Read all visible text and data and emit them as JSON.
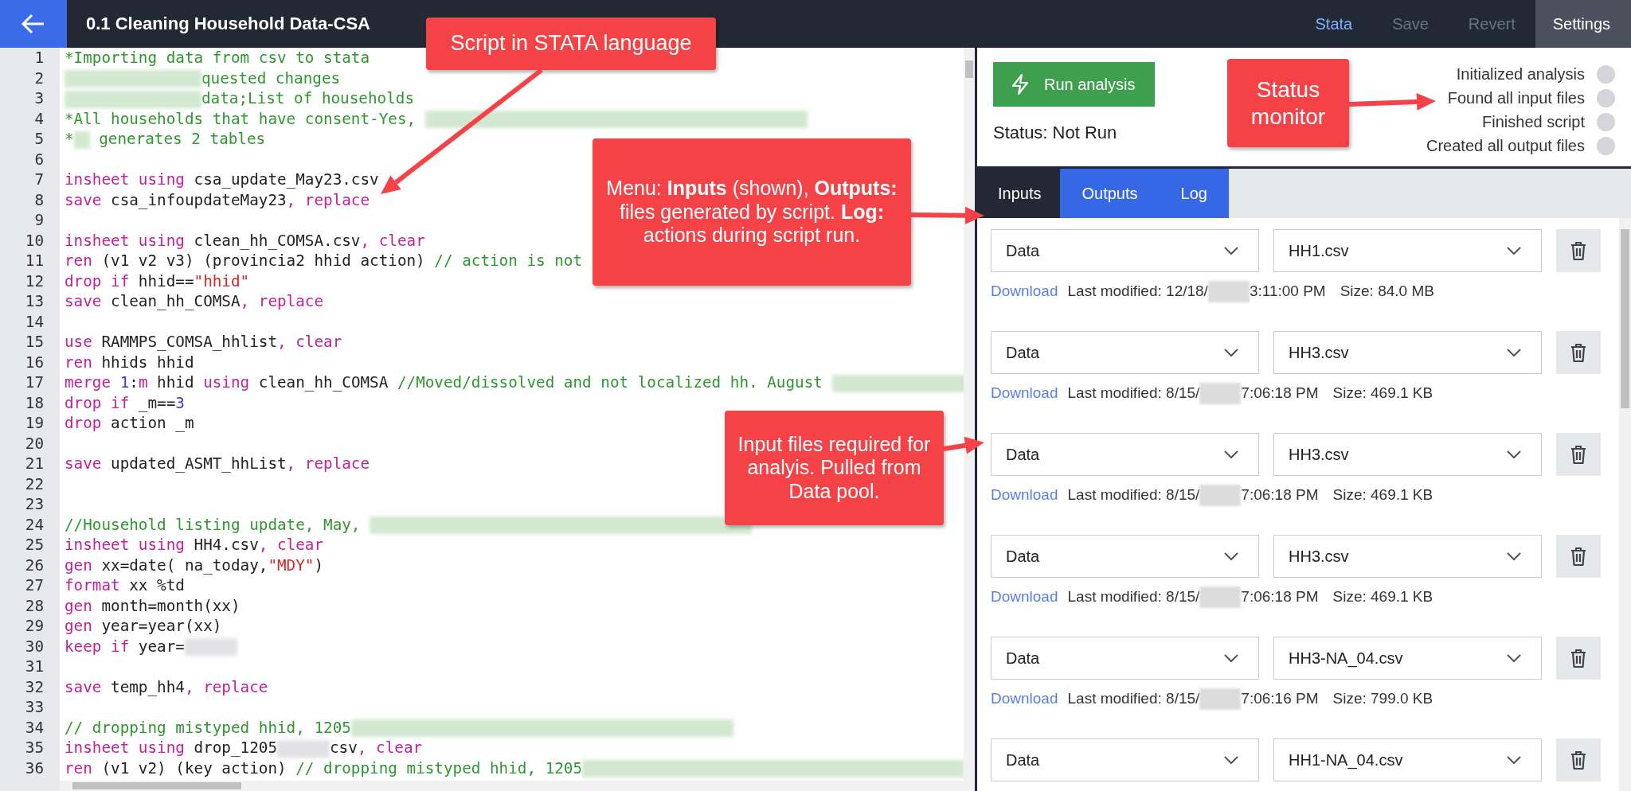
{
  "top_bar": {
    "title": "0.1 Cleaning Household Data-CSA",
    "actions": [
      {
        "label": "Stata",
        "kind": "link",
        "selected": true,
        "disabled": false
      },
      {
        "label": "Save",
        "kind": "link",
        "selected": false,
        "disabled": true
      },
      {
        "label": "Revert",
        "kind": "link",
        "selected": false,
        "disabled": true
      },
      {
        "label": "Settings",
        "kind": "panel",
        "selected": false,
        "disabled": false
      }
    ]
  },
  "editor": {
    "lines": [
      {
        "number": "1",
        "tokens": [
          {
            "kind": "comment",
            "text": "*Importing data from csv to stata"
          }
        ]
      },
      {
        "number": "2",
        "tokens": [
          {
            "kind": "redacted"
          },
          {
            "kind": "comment",
            "text": "quested changes"
          }
        ]
      },
      {
        "number": "3",
        "tokens": [
          {
            "kind": "redacted"
          },
          {
            "kind": "comment",
            "text": "data;List of households"
          }
        ]
      },
      {
        "number": "4",
        "tokens": [
          {
            "kind": "comment",
            "text": "*All households that have consent-Yes, "
          },
          {
            "kind": "redacted"
          }
        ]
      },
      {
        "number": "5",
        "tokens": [
          {
            "kind": "comment",
            "text": "*"
          },
          {
            "kind": "redacted"
          },
          {
            "kind": "comment",
            "text": " generates 2 tables"
          }
        ]
      },
      {
        "number": "6"
      },
      {
        "number": "7",
        "tokens": [
          {
            "kind": "keyword",
            "text": "insheet using"
          },
          {
            "kind": "plain",
            "text": " csa_update_May23.csv"
          }
        ]
      },
      {
        "number": "8",
        "tokens": [
          {
            "kind": "keyword",
            "text": "save"
          },
          {
            "kind": "plain",
            "text": " csa_infoupdateMay23"
          },
          {
            "kind": "keyword",
            "text": ", replace"
          }
        ]
      },
      {
        "number": "9"
      },
      {
        "number": "10",
        "tokens": [
          {
            "kind": "keyword",
            "text": "insheet using"
          },
          {
            "kind": "plain",
            "text": " clean_hh_COMSA.csv"
          },
          {
            "kind": "keyword",
            "text": ", clear"
          }
        ]
      },
      {
        "number": "11",
        "tokens": [
          {
            "kind": "keyword",
            "text": "ren"
          },
          {
            "kind": "plain",
            "text": " (v1 v2 v3) (provincia2 hhid action) "
          },
          {
            "kind": "comment",
            "text": "// action is not"
          }
        ]
      },
      {
        "number": "12",
        "tokens": [
          {
            "kind": "keyword",
            "text": "drop if"
          },
          {
            "kind": "plain",
            "text": " hhid=="
          },
          {
            "kind": "string",
            "text": "\"hhid\""
          }
        ]
      },
      {
        "number": "13",
        "tokens": [
          {
            "kind": "keyword",
            "text": "save"
          },
          {
            "kind": "plain",
            "text": " clean_hh_COMSA"
          },
          {
            "kind": "keyword",
            "text": ", replace"
          }
        ]
      },
      {
        "number": "14"
      },
      {
        "number": "15",
        "tokens": [
          {
            "kind": "keyword",
            "text": "use"
          },
          {
            "kind": "plain",
            "text": " RAMMPS_COMSA_hhlist"
          },
          {
            "kind": "keyword",
            "text": ", clear"
          }
        ]
      },
      {
        "number": "16",
        "tokens": [
          {
            "kind": "keyword",
            "text": "ren"
          },
          {
            "kind": "plain",
            "text": " hhids hhid"
          }
        ]
      },
      {
        "number": "17",
        "tokens": [
          {
            "kind": "keyword",
            "text": "merge"
          },
          {
            "kind": "number",
            "text": " 1"
          },
          {
            "kind": "plain",
            "text": ":"
          },
          {
            "kind": "keyword",
            "text": "m"
          },
          {
            "kind": "plain",
            "text": " hhid "
          },
          {
            "kind": "keyword",
            "text": "using"
          },
          {
            "kind": "plain",
            "text": " clean_hh_COMSA "
          },
          {
            "kind": "comment",
            "text": "//Moved/dissolved and not localized hh. August "
          },
          {
            "kind": "redacted"
          }
        ]
      },
      {
        "number": "18",
        "tokens": [
          {
            "kind": "keyword",
            "text": "drop if"
          },
          {
            "kind": "plain",
            "text": " _m=="
          },
          {
            "kind": "number",
            "text": "3"
          }
        ]
      },
      {
        "number": "19",
        "tokens": [
          {
            "kind": "keyword",
            "text": "drop"
          },
          {
            "kind": "plain",
            "text": " action _m"
          }
        ]
      },
      {
        "number": "20"
      },
      {
        "number": "21",
        "tokens": [
          {
            "kind": "keyword",
            "text": "save"
          },
          {
            "kind": "plain",
            "text": " updated_ASMT_hhList"
          },
          {
            "kind": "keyword",
            "text": ", replace"
          }
        ]
      },
      {
        "number": "22"
      },
      {
        "number": "23"
      },
      {
        "number": "24",
        "tokens": [
          {
            "kind": "comment",
            "text": "//Household listing update, May, "
          },
          {
            "kind": "redacted"
          }
        ]
      },
      {
        "number": "25",
        "tokens": [
          {
            "kind": "keyword",
            "text": "insheet using"
          },
          {
            "kind": "plain",
            "text": " HH4.csv"
          },
          {
            "kind": "keyword",
            "text": ", clear"
          }
        ]
      },
      {
        "number": "26",
        "tokens": [
          {
            "kind": "keyword",
            "text": "gen"
          },
          {
            "kind": "plain",
            "text": " xx=date( na_today,"
          },
          {
            "kind": "string",
            "text": "\"MDY\""
          },
          {
            "kind": "plain",
            "text": ")"
          }
        ]
      },
      {
        "number": "27",
        "tokens": [
          {
            "kind": "keyword",
            "text": "format"
          },
          {
            "kind": "plain",
            "text": " xx %td"
          }
        ]
      },
      {
        "number": "28",
        "tokens": [
          {
            "kind": "keyword",
            "text": "gen"
          },
          {
            "kind": "plain",
            "text": " month=month(xx)"
          }
        ]
      },
      {
        "number": "29",
        "tokens": [
          {
            "kind": "keyword",
            "text": "gen"
          },
          {
            "kind": "plain",
            "text": " year=year(xx)"
          }
        ]
      },
      {
        "number": "30",
        "tokens": [
          {
            "kind": "keyword",
            "text": "keep if"
          },
          {
            "kind": "plain",
            "text": " year="
          },
          {
            "kind": "redacted"
          }
        ]
      },
      {
        "number": "31"
      },
      {
        "number": "32",
        "tokens": [
          {
            "kind": "keyword",
            "text": "save"
          },
          {
            "kind": "plain",
            "text": " temp_hh4"
          },
          {
            "kind": "keyword",
            "text": ", replace"
          }
        ]
      },
      {
        "number": "33"
      },
      {
        "number": "34",
        "tokens": [
          {
            "kind": "comment",
            "text": "// dropping mistyped hhid, 1205"
          },
          {
            "kind": "redacted"
          }
        ]
      },
      {
        "number": "35",
        "tokens": [
          {
            "kind": "keyword",
            "text": "insheet using"
          },
          {
            "kind": "plain",
            "text": " drop_1205"
          },
          {
            "kind": "redacted"
          },
          {
            "kind": "plain",
            "text": "csv"
          },
          {
            "kind": "keyword",
            "text": ", clear"
          }
        ]
      },
      {
        "number": "36",
        "tokens": [
          {
            "kind": "keyword",
            "text": "ren"
          },
          {
            "kind": "plain",
            "text": " (v1 v2) (key action) "
          },
          {
            "kind": "comment",
            "text": "// dropping mistyped hhid, 1205"
          },
          {
            "kind": "redacted"
          }
        ]
      }
    ]
  },
  "run_panel": {
    "button": "Run analysis",
    "status": "Status: Not Run",
    "steps": [
      {
        "label": "Initialized analysis",
        "done": false
      },
      {
        "label": "Found all input files",
        "done": false
      },
      {
        "label": "Finished script",
        "done": false
      },
      {
        "label": "Created all output files",
        "done": false
      }
    ]
  },
  "tabs": [
    {
      "label": "Inputs",
      "selected": true
    },
    {
      "label": "Outputs",
      "selected": false
    },
    {
      "label": "Log",
      "selected": false
    }
  ],
  "inputs": [
    {
      "source": "Data",
      "file": "HH1.csv",
      "link": "Download",
      "modified_date": "Last modified: 12/18/",
      "modified_time": "3:11:00 PM",
      "size": "Size: 84.0 MB"
    },
    {
      "source": "Data",
      "file": "HH3.csv",
      "link": "Download",
      "modified_date": "Last modified: 8/15/",
      "modified_time": "7:06:18 PM",
      "size": "Size: 469.1 KB"
    },
    {
      "source": "Data",
      "file": "HH3.csv",
      "link": "Download",
      "modified_date": "Last modified: 8/15/",
      "modified_time": "7:06:18 PM",
      "size": "Size: 469.1 KB"
    },
    {
      "source": "Data",
      "file": "HH3.csv",
      "link": "Download",
      "modified_date": "Last modified: 8/15/",
      "modified_time": "7:06:18 PM",
      "size": "Size: 469.1 KB"
    },
    {
      "source": "Data",
      "file": "HH3-NA_04.csv",
      "link": "Download",
      "modified_date": "Last modified: 8/15/",
      "modified_time": "7:06:16 PM",
      "size": "Size: 799.0 KB"
    },
    {
      "source": "Data",
      "file": "HH1-NA_04.csv"
    }
  ],
  "annotations": [
    {
      "text": "Script in STATA language"
    },
    {
      "text": "Menu:  **Inputs** (shown), **Outputs:** files generated by script.  **Log:**  actions during script run."
    },
    {
      "text": "Status monitor"
    },
    {
      "text": "Input files required for analyis.  Pulled from Data pool."
    }
  ]
}
